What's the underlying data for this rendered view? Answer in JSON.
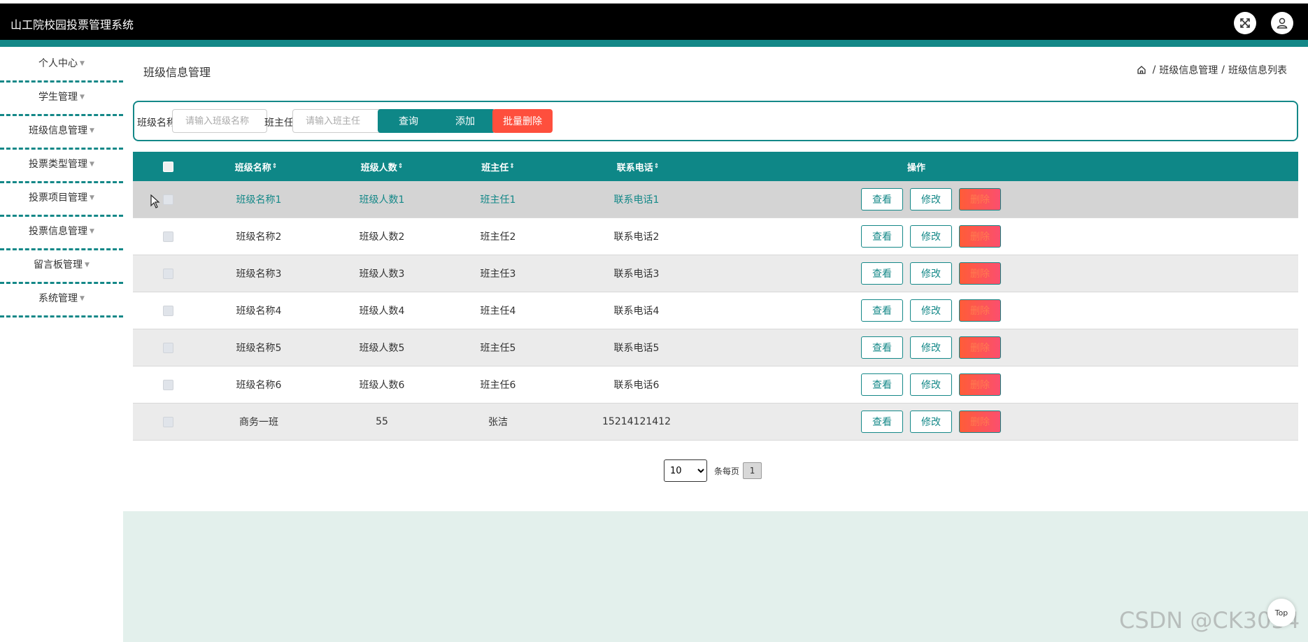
{
  "header": {
    "app_title": "山工院校园投票管理系统",
    "fullscreen_icon": "fullscreen-icon",
    "user_icon": "user-icon"
  },
  "sidebar": {
    "items": [
      {
        "label": "个人中心"
      },
      {
        "label": "学生管理"
      },
      {
        "label": "班级信息管理"
      },
      {
        "label": "投票类型管理"
      },
      {
        "label": "投票项目管理"
      },
      {
        "label": "投票信息管理"
      },
      {
        "label": "留言板管理"
      },
      {
        "label": "系统管理"
      }
    ]
  },
  "page": {
    "title": "班级信息管理",
    "breadcrumb": [
      "班级信息管理",
      "班级信息列表"
    ]
  },
  "search": {
    "class_label": "班级名称",
    "class_placeholder": "请输入班级名称",
    "teacher_label": "班主任",
    "teacher_placeholder": "请输入班主任",
    "query_label": "查询",
    "add_label": "添加",
    "batch_delete_label": "批量删除"
  },
  "table": {
    "columns": [
      "班级名称",
      "班级人数",
      "班主任",
      "联系电话",
      "操作"
    ],
    "sort_glyph": "⇕",
    "rows": [
      {
        "name": "班级名称1",
        "count": "班级人数1",
        "teacher": "班主任1",
        "phone": "联系电话1"
      },
      {
        "name": "班级名称2",
        "count": "班级人数2",
        "teacher": "班主任2",
        "phone": "联系电话2"
      },
      {
        "name": "班级名称3",
        "count": "班级人数3",
        "teacher": "班主任3",
        "phone": "联系电话3"
      },
      {
        "name": "班级名称4",
        "count": "班级人数4",
        "teacher": "班主任4",
        "phone": "联系电话4"
      },
      {
        "name": "班级名称5",
        "count": "班级人数5",
        "teacher": "班主任5",
        "phone": "联系电话5"
      },
      {
        "name": "班级名称6",
        "count": "班级人数6",
        "teacher": "班主任6",
        "phone": "联系电话6"
      },
      {
        "name": "商务一班",
        "count": "55",
        "teacher": "张洁",
        "phone": "15214121412"
      }
    ],
    "actions": {
      "view": "查看",
      "edit": "修改",
      "delete": "删除"
    }
  },
  "pagination": {
    "page_size": "10",
    "per_page_label": "条每页",
    "current_page": "1"
  },
  "top_button": "Top",
  "watermark": "CSDN @CK3034",
  "colors": {
    "primary": "#0e8787",
    "danger": "#fe4f3d",
    "topbar": "#000000"
  }
}
